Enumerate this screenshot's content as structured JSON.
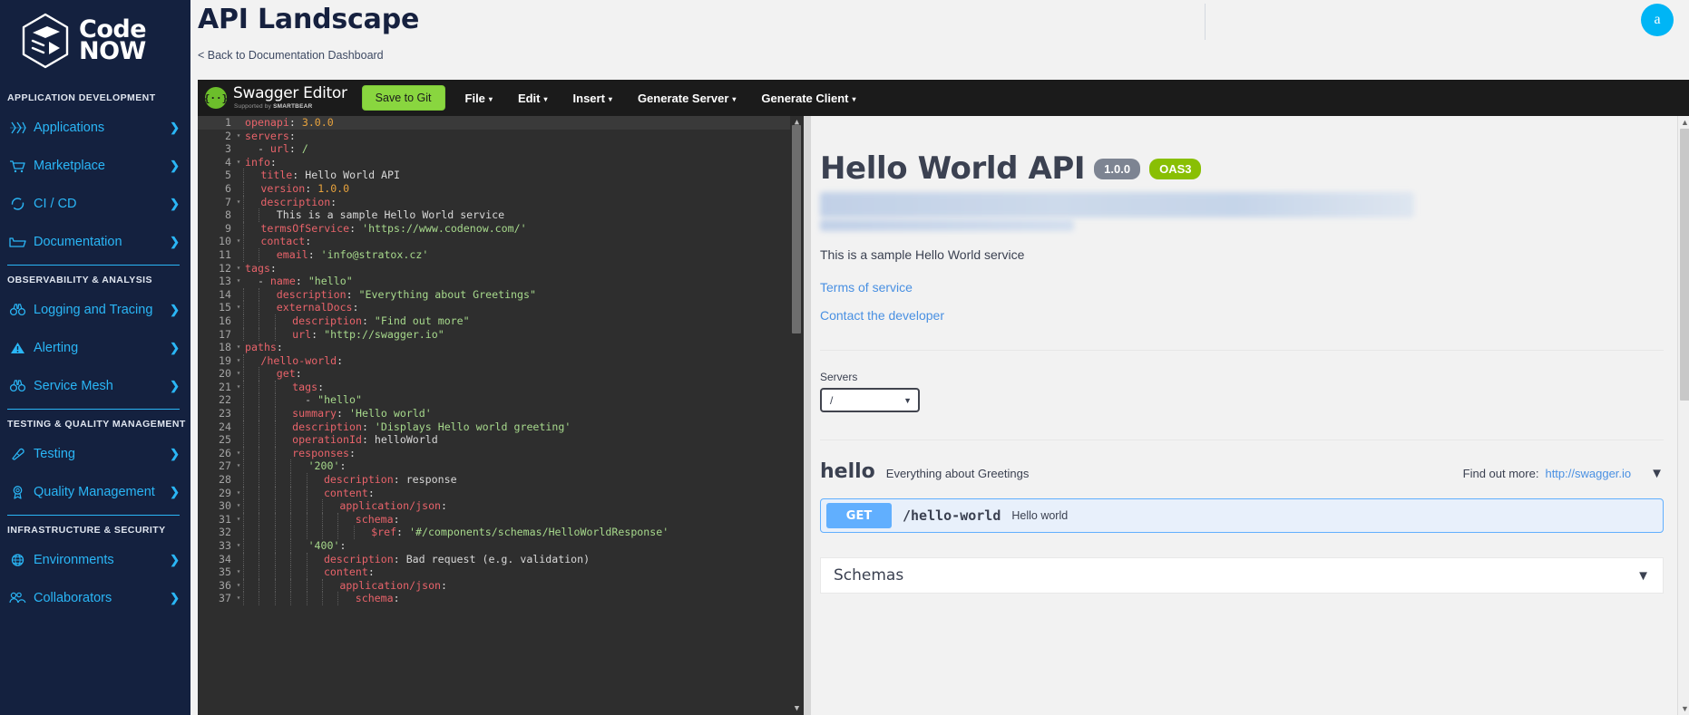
{
  "sidebar": {
    "brand": {
      "line1": "Code",
      "line2": "NOW",
      "logo_icon": "codenow-hexagon-logo"
    },
    "sections": [
      {
        "label": "APPLICATION DEVELOPMENT",
        "items": [
          {
            "label": "Applications",
            "icon": "applications-icon"
          },
          {
            "label": "Marketplace",
            "icon": "cart-icon"
          },
          {
            "label": "CI / CD",
            "icon": "circle-arrows-icon"
          },
          {
            "label": "Documentation",
            "icon": "folder-icon"
          }
        ]
      },
      {
        "label": "OBSERVABILITY & ANALYSIS",
        "items": [
          {
            "label": "Logging and Tracing",
            "icon": "binoculars-icon"
          },
          {
            "label": "Alerting",
            "icon": "warning-triangle-icon"
          },
          {
            "label": "Service Mesh",
            "icon": "binoculars-icon"
          }
        ]
      },
      {
        "label": "TESTING & QUALITY MANAGEMENT",
        "items": [
          {
            "label": "Testing",
            "icon": "test-tube-icon"
          },
          {
            "label": "Quality Management",
            "icon": "award-ribbon-icon"
          }
        ]
      },
      {
        "label": "INFRASTRUCTURE & SECURITY",
        "items": [
          {
            "label": "Environments",
            "icon": "globe-icon"
          },
          {
            "label": "Collaborators",
            "icon": "people-icon"
          }
        ]
      }
    ],
    "chevron": "❯"
  },
  "header": {
    "title": "API Landscape",
    "back_link": "< Back to Documentation Dashboard",
    "avatar_initial": "a",
    "avatar_color": "#00b5f5"
  },
  "swagger_toolbar": {
    "logo_glyph": "{··}",
    "brand": "Swagger Editor",
    "brand_sub_prefix": "Supported by ",
    "brand_sub_bold": "SMARTBEAR",
    "save_label": "Save to Git",
    "save_color": "#89d63f",
    "menus": [
      {
        "label": "File"
      },
      {
        "label": "Edit"
      },
      {
        "label": "Insert"
      },
      {
        "label": "Generate Server"
      },
      {
        "label": "Generate Client"
      }
    ],
    "caret": "▾"
  },
  "editor": {
    "lines": [
      {
        "n": 1,
        "fold": "",
        "guides": 0,
        "active": true,
        "tokens": [
          {
            "t": "openapi",
            "c": "k"
          },
          {
            "t": ": ",
            "c": "p"
          },
          {
            "t": "3.0.0",
            "c": "n"
          }
        ]
      },
      {
        "n": 2,
        "fold": "▾",
        "guides": 0,
        "tokens": [
          {
            "t": "servers",
            "c": "k"
          },
          {
            "t": ":",
            "c": "p"
          }
        ]
      },
      {
        "n": 3,
        "fold": "",
        "guides": 0,
        "tokens": [
          {
            "t": "  - ",
            "c": "d"
          },
          {
            "t": "url",
            "c": "k"
          },
          {
            "t": ": ",
            "c": "p"
          },
          {
            "t": "/",
            "c": "s"
          }
        ]
      },
      {
        "n": 4,
        "fold": "▾",
        "guides": 0,
        "tokens": [
          {
            "t": "info",
            "c": "k"
          },
          {
            "t": ":",
            "c": "p"
          }
        ]
      },
      {
        "n": 5,
        "fold": "",
        "guides": 1,
        "tokens": [
          {
            "t": "title",
            "c": "k"
          },
          {
            "t": ": ",
            "c": "p"
          },
          {
            "t": "Hello World API",
            "c": "p"
          }
        ]
      },
      {
        "n": 6,
        "fold": "",
        "guides": 1,
        "tokens": [
          {
            "t": "version",
            "c": "k"
          },
          {
            "t": ": ",
            "c": "p"
          },
          {
            "t": "1.0.0",
            "c": "n"
          }
        ]
      },
      {
        "n": 7,
        "fold": "▾",
        "guides": 1,
        "tokens": [
          {
            "t": "description",
            "c": "k"
          },
          {
            "t": ":",
            "c": "p"
          }
        ]
      },
      {
        "n": 8,
        "fold": "",
        "guides": 2,
        "tokens": [
          {
            "t": "This is a sample Hello World service",
            "c": "p"
          }
        ]
      },
      {
        "n": 9,
        "fold": "",
        "guides": 1,
        "tokens": [
          {
            "t": "termsOfService",
            "c": "k"
          },
          {
            "t": ": ",
            "c": "p"
          },
          {
            "t": "'https://www.codenow.com/'",
            "c": "s"
          }
        ]
      },
      {
        "n": 10,
        "fold": "▾",
        "guides": 1,
        "tokens": [
          {
            "t": "contact",
            "c": "k"
          },
          {
            "t": ":",
            "c": "p"
          }
        ]
      },
      {
        "n": 11,
        "fold": "",
        "guides": 2,
        "tokens": [
          {
            "t": "email",
            "c": "k"
          },
          {
            "t": ": ",
            "c": "p"
          },
          {
            "t": "'info@stratox.cz'",
            "c": "s"
          }
        ]
      },
      {
        "n": 12,
        "fold": "▾",
        "guides": 0,
        "tokens": [
          {
            "t": "tags",
            "c": "k"
          },
          {
            "t": ":",
            "c": "p"
          }
        ]
      },
      {
        "n": 13,
        "fold": "▾",
        "guides": 0,
        "tokens": [
          {
            "t": "  - ",
            "c": "d"
          },
          {
            "t": "name",
            "c": "k"
          },
          {
            "t": ": ",
            "c": "p"
          },
          {
            "t": "\"hello\"",
            "c": "s"
          }
        ]
      },
      {
        "n": 14,
        "fold": "",
        "guides": 2,
        "tokens": [
          {
            "t": "description",
            "c": "k"
          },
          {
            "t": ": ",
            "c": "p"
          },
          {
            "t": "\"Everything about Greetings\"",
            "c": "s"
          }
        ]
      },
      {
        "n": 15,
        "fold": "▾",
        "guides": 2,
        "tokens": [
          {
            "t": "externalDocs",
            "c": "k"
          },
          {
            "t": ":",
            "c": "p"
          }
        ]
      },
      {
        "n": 16,
        "fold": "",
        "guides": 3,
        "tokens": [
          {
            "t": "description",
            "c": "k"
          },
          {
            "t": ": ",
            "c": "p"
          },
          {
            "t": "\"Find out more\"",
            "c": "s"
          }
        ]
      },
      {
        "n": 17,
        "fold": "",
        "guides": 3,
        "tokens": [
          {
            "t": "url",
            "c": "k"
          },
          {
            "t": ": ",
            "c": "p"
          },
          {
            "t": "\"http://swagger.io\"",
            "c": "s"
          }
        ]
      },
      {
        "n": 18,
        "fold": "▾",
        "guides": 0,
        "tokens": [
          {
            "t": "paths",
            "c": "k"
          },
          {
            "t": ":",
            "c": "p"
          }
        ]
      },
      {
        "n": 19,
        "fold": "▾",
        "guides": 1,
        "tokens": [
          {
            "t": "/hello-world",
            "c": "k"
          },
          {
            "t": ":",
            "c": "p"
          }
        ]
      },
      {
        "n": 20,
        "fold": "▾",
        "guides": 2,
        "tokens": [
          {
            "t": "get",
            "c": "k"
          },
          {
            "t": ":",
            "c": "p"
          }
        ]
      },
      {
        "n": 21,
        "fold": "▾",
        "guides": 3,
        "tokens": [
          {
            "t": "tags",
            "c": "k"
          },
          {
            "t": ":",
            "c": "p"
          }
        ]
      },
      {
        "n": 22,
        "fold": "",
        "guides": 3,
        "tokens": [
          {
            "t": "  - ",
            "c": "d"
          },
          {
            "t": "\"hello\"",
            "c": "s"
          }
        ]
      },
      {
        "n": 23,
        "fold": "",
        "guides": 3,
        "tokens": [
          {
            "t": "summary",
            "c": "k"
          },
          {
            "t": ": ",
            "c": "p"
          },
          {
            "t": "'Hello world'",
            "c": "s"
          }
        ]
      },
      {
        "n": 24,
        "fold": "",
        "guides": 3,
        "tokens": [
          {
            "t": "description",
            "c": "k"
          },
          {
            "t": ": ",
            "c": "p"
          },
          {
            "t": "'Displays Hello world greeting'",
            "c": "s"
          }
        ]
      },
      {
        "n": 25,
        "fold": "",
        "guides": 3,
        "tokens": [
          {
            "t": "operationId",
            "c": "k"
          },
          {
            "t": ": ",
            "c": "p"
          },
          {
            "t": "helloWorld",
            "c": "p"
          }
        ]
      },
      {
        "n": 26,
        "fold": "▾",
        "guides": 3,
        "tokens": [
          {
            "t": "responses",
            "c": "k"
          },
          {
            "t": ":",
            "c": "p"
          }
        ]
      },
      {
        "n": 27,
        "fold": "▾",
        "guides": 4,
        "tokens": [
          {
            "t": "'200'",
            "c": "s"
          },
          {
            "t": ":",
            "c": "p"
          }
        ]
      },
      {
        "n": 28,
        "fold": "",
        "guides": 5,
        "tokens": [
          {
            "t": "description",
            "c": "k"
          },
          {
            "t": ": ",
            "c": "p"
          },
          {
            "t": "response",
            "c": "p"
          }
        ]
      },
      {
        "n": 29,
        "fold": "▾",
        "guides": 5,
        "tokens": [
          {
            "t": "content",
            "c": "k"
          },
          {
            "t": ":",
            "c": "p"
          }
        ]
      },
      {
        "n": 30,
        "fold": "▾",
        "guides": 6,
        "tokens": [
          {
            "t": "application/json",
            "c": "k"
          },
          {
            "t": ":",
            "c": "p"
          }
        ]
      },
      {
        "n": 31,
        "fold": "▾",
        "guides": 7,
        "tokens": [
          {
            "t": "schema",
            "c": "k"
          },
          {
            "t": ":",
            "c": "p"
          }
        ]
      },
      {
        "n": 32,
        "fold": "",
        "guides": 8,
        "tokens": [
          {
            "t": "$ref",
            "c": "k"
          },
          {
            "t": ": ",
            "c": "p"
          },
          {
            "t": "'#/components/schemas/HelloWorldResponse'",
            "c": "s"
          }
        ]
      },
      {
        "n": 33,
        "fold": "▾",
        "guides": 4,
        "tokens": [
          {
            "t": "'400'",
            "c": "s"
          },
          {
            "t": ":",
            "c": "p"
          }
        ]
      },
      {
        "n": 34,
        "fold": "",
        "guides": 5,
        "tokens": [
          {
            "t": "description",
            "c": "k"
          },
          {
            "t": ": ",
            "c": "p"
          },
          {
            "t": "Bad request (e.g. validation)",
            "c": "p"
          }
        ]
      },
      {
        "n": 35,
        "fold": "▾",
        "guides": 5,
        "tokens": [
          {
            "t": "content",
            "c": "k"
          },
          {
            "t": ":",
            "c": "p"
          }
        ]
      },
      {
        "n": 36,
        "fold": "▾",
        "guides": 6,
        "tokens": [
          {
            "t": "application/json",
            "c": "k"
          },
          {
            "t": ":",
            "c": "p"
          }
        ]
      },
      {
        "n": 37,
        "fold": "▾",
        "guides": 7,
        "tokens": [
          {
            "t": "schema",
            "c": "k"
          },
          {
            "t": ":",
            "c": "p"
          }
        ]
      }
    ]
  },
  "preview": {
    "api_title": "Hello World API",
    "version_badge": "1.0.0",
    "oas_badge": "OAS3",
    "description": "This is a sample Hello World service",
    "terms_link": "Terms of service",
    "contact_link": "Contact the developer",
    "servers_label": "Servers",
    "servers_selected": "/",
    "tag": {
      "name": "hello",
      "description": "Everything about Greetings",
      "ext_label": "Find out more:",
      "ext_link": "http://swagger.io"
    },
    "operation": {
      "method": "GET",
      "method_color": "#61affe",
      "path": "/hello-world",
      "summary": "Hello world"
    },
    "schemas_title": "Schemas",
    "chevron_down": "⌄"
  }
}
